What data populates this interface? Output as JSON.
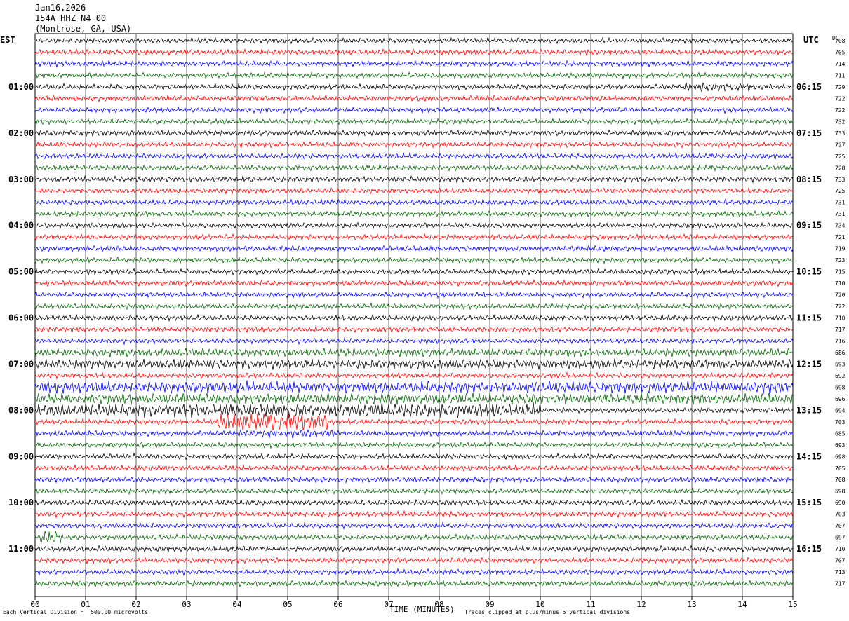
{
  "header": {
    "date": "Jan16,2026",
    "station": "154A HHZ N4 00",
    "location": "(Montrose, GA, USA)"
  },
  "left_tz": "EST",
  "right_tz": "UTC",
  "dc_label": "DC",
  "footer": {
    "scale": "Each Vertical Division =  500.00 microvolts",
    "clip": "Traces clipped at plus/minus 5 vertical divisions"
  },
  "colors": [
    "#000000",
    "#ff0000",
    "#0000ff",
    "#006400"
  ],
  "chart_data": {
    "type": "line",
    "xlabel": "TIME (MINUTES)",
    "xlim": [
      0,
      15
    ],
    "x_ticks": [
      "00",
      "01",
      "02",
      "03",
      "04",
      "05",
      "06",
      "07",
      "08",
      "09",
      "10",
      "11",
      "12",
      "13",
      "14",
      "15"
    ],
    "left_hour_labels": [
      "01:00",
      "02:00",
      "03:00",
      "04:00",
      "05:00",
      "06:00",
      "07:00",
      "08:00",
      "09:00",
      "10:00",
      "11:00"
    ],
    "right_hour_labels": [
      "06:15",
      "07:15",
      "08:15",
      "09:15",
      "10:15",
      "11:15",
      "12:15",
      "13:15",
      "14:15",
      "15:15",
      "16:15"
    ],
    "dc_offsets": [
      708,
      705,
      714,
      711,
      729,
      722,
      722,
      732,
      733,
      727,
      725,
      728,
      733,
      725,
      731,
      731,
      734,
      721,
      719,
      723,
      715,
      710,
      720,
      722,
      710,
      717,
      716,
      686,
      693,
      692,
      698,
      696,
      694,
      703,
      685,
      693,
      698,
      705,
      708,
      698,
      690,
      703,
      707,
      697,
      710,
      707,
      713,
      717
    ],
    "noise_bursts": [
      {
        "trace": 4,
        "minute_start": 12.8,
        "minute_end": 14.2,
        "amplitude": 1.6
      },
      {
        "trace": 27,
        "minute_start": 0,
        "minute_end": 15,
        "amplitude": 1.5
      },
      {
        "trace": 28,
        "minute_start": 0,
        "minute_end": 15,
        "amplitude": 1.8
      },
      {
        "trace": 30,
        "minute_start": 0,
        "minute_end": 15,
        "amplitude": 2.2
      },
      {
        "trace": 31,
        "minute_start": 0,
        "minute_end": 15,
        "amplitude": 2.0
      },
      {
        "trace": 32,
        "minute_start": 0,
        "minute_end": 10,
        "amplitude": 2.6
      },
      {
        "trace": 33,
        "minute_start": 3.6,
        "minute_end": 5.8,
        "amplitude": 3.5
      },
      {
        "trace": 34,
        "minute_start": 4.0,
        "minute_end": 6.0,
        "amplitude": 1.5
      },
      {
        "trace": 43,
        "minute_start": 0.1,
        "minute_end": 0.5,
        "amplitude": 3.0
      }
    ]
  }
}
